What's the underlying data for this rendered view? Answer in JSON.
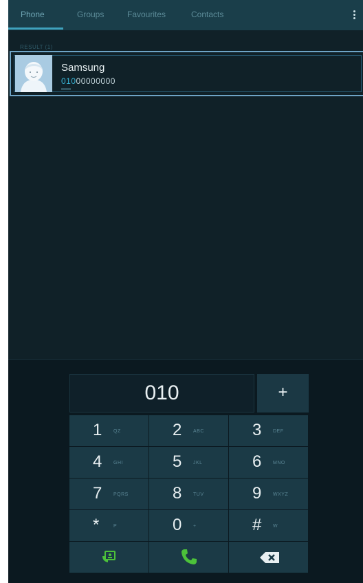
{
  "tabs": [
    {
      "label": "Phone",
      "active": true
    },
    {
      "label": "Groups",
      "active": false
    },
    {
      "label": "Favourites",
      "active": false
    },
    {
      "label": "Contacts",
      "active": false
    }
  ],
  "menu_icon": "more-vert-icon",
  "search": {
    "header": "RESULT (1)",
    "contact": {
      "name": "Samsung",
      "number_match": "010",
      "number_rest": "00000000",
      "type_label": "Mobile"
    }
  },
  "dialer": {
    "entered_number": "010",
    "plus_label": "+",
    "keys": [
      {
        "digit": "1",
        "letters": "QZ"
      },
      {
        "digit": "2",
        "letters": "ABC"
      },
      {
        "digit": "3",
        "letters": "DEF"
      },
      {
        "digit": "4",
        "letters": "GHI"
      },
      {
        "digit": "5",
        "letters": "JKL"
      },
      {
        "digit": "6",
        "letters": "MNO"
      },
      {
        "digit": "7",
        "letters": "PQRS"
      },
      {
        "digit": "8",
        "letters": "TUV"
      },
      {
        "digit": "9",
        "letters": "WXYZ"
      },
      {
        "digit": "*",
        "letters": "P"
      },
      {
        "digit": "0",
        "letters": "+"
      },
      {
        "digit": "#",
        "letters": "W"
      }
    ],
    "actions": [
      {
        "icon": "contacts-add-icon"
      },
      {
        "icon": "call-icon"
      },
      {
        "icon": "backspace-icon"
      }
    ],
    "colors": {
      "call_green": "#4cc23a",
      "accent_blue": "#38b4d6"
    }
  }
}
